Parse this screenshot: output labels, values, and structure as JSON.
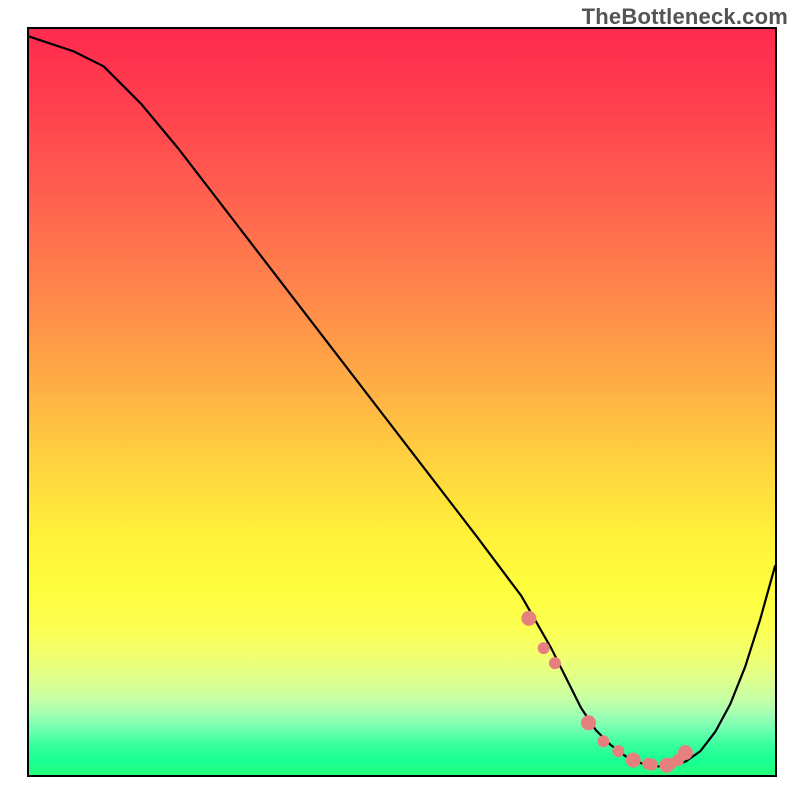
{
  "watermark": "TheBottleneck.com",
  "chart_data": {
    "type": "line",
    "title": "",
    "xlabel": "",
    "ylabel": "",
    "xlim": [
      0,
      100
    ],
    "ylim": [
      0,
      100
    ],
    "series": [
      {
        "name": "bottleneck-curve",
        "x": [
          0,
          3,
          6,
          10,
          15,
          20,
          30,
          40,
          50,
          60,
          66,
          70,
          72,
          74,
          76,
          78,
          80,
          82,
          84,
          85,
          86,
          88,
          90,
          92,
          94,
          96,
          98,
          100
        ],
        "y": [
          99,
          98,
          97,
          95,
          90,
          84,
          71,
          58,
          45,
          32,
          24,
          17,
          13,
          9,
          6,
          4,
          2.5,
          1.6,
          1.2,
          1.1,
          1.2,
          1.8,
          3.2,
          5.8,
          9.5,
          14.5,
          20.8,
          28
        ]
      }
    ],
    "markers": {
      "name": "highlight-dots",
      "x": [
        67,
        69,
        70.5,
        75,
        77,
        79,
        81,
        83,
        83.5,
        85.5,
        86,
        87,
        88
      ],
      "y": [
        21,
        17,
        15,
        7,
        4.5,
        3.2,
        2,
        1.5,
        1.4,
        1.3,
        1.5,
        2.0,
        3.0
      ],
      "color": "#e6807f"
    },
    "gradient_bands": [
      {
        "y": 0,
        "color": "#ff2b4f"
      },
      {
        "y": 50,
        "color": "#ffd23f"
      },
      {
        "y": 85,
        "color": "#f1ff6e"
      },
      {
        "y": 100,
        "color": "#26ff7a"
      }
    ]
  }
}
